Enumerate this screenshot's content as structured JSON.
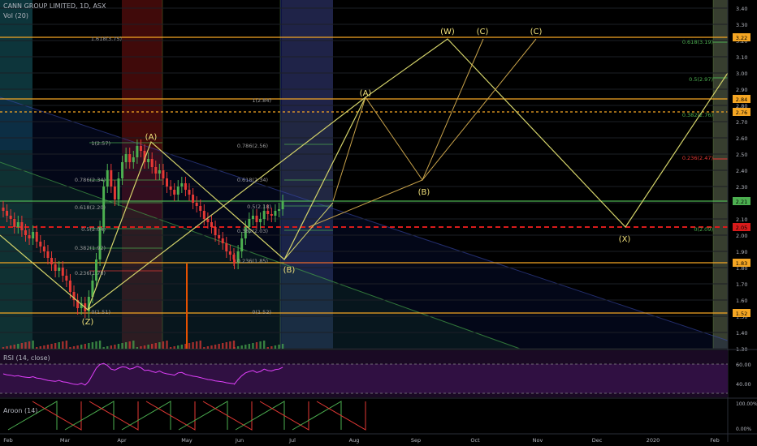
{
  "header": {
    "symbol_title": "CANN GROUP LIMITED, 1D, ASX",
    "volume_label": "Vol (20)",
    "rsi_label": "RSI (14, close)",
    "aroon_label": "Aroon (14)"
  },
  "colors": {
    "up": "#4caf50",
    "down": "#e53935",
    "orange": "#f5a623",
    "yellow_line": "#d4d36a",
    "rsi": "#e040fb",
    "axis_text": "#b2b5be",
    "dashed_red": "#d81b1b"
  },
  "chart_data": {
    "type": "candlestick",
    "title": "CANN GROUP LIMITED, 1D, ASX",
    "ylim": [
      1.3,
      3.45
    ],
    "y_ticks": [
      "1.30",
      "1.40",
      "1.50",
      "1.60",
      "1.70",
      "1.80",
      "1.90",
      "2.00",
      "2.10",
      "2.20",
      "2.30",
      "2.40",
      "2.50",
      "2.60",
      "2.70",
      "2.80",
      "2.90",
      "3.00",
      "3.10",
      "3.20",
      "3.30",
      "3.40"
    ],
    "x_ticks": [
      "Feb",
      "Mar",
      "Apr",
      "May",
      "Jun",
      "Jul",
      "Aug",
      "Sep",
      "Oct",
      "Nov",
      "Dec",
      "2020",
      "Feb"
    ],
    "price_badges": [
      {
        "label": "3.22",
        "value": 3.22,
        "color": "#f5a623"
      },
      {
        "label": "2.84",
        "value": 2.84,
        "color": "#f5a623"
      },
      {
        "label": "2.76",
        "value": 2.76,
        "color": "#f5a623"
      },
      {
        "label": "2.21",
        "value": 2.21,
        "color": "#4caf50"
      },
      {
        "label": "2.05",
        "value": 2.05,
        "color": "#d81b1b"
      },
      {
        "label": "1.83",
        "value": 1.83,
        "color": "#f5a623"
      },
      {
        "label": "1.52",
        "value": 1.52,
        "color": "#f5a623"
      }
    ],
    "horizontal_levels": [
      3.22,
      2.84,
      2.76,
      2.21,
      2.05,
      1.83,
      1.52
    ],
    "wave_labels": [
      {
        "label": "(A)",
        "x_day": 40,
        "value": 2.6
      },
      {
        "label": "(Z)",
        "x_day": 22,
        "value": 1.45
      },
      {
        "label": "(B)",
        "x_day": 80,
        "value": 1.78
      },
      {
        "label": "(A)",
        "x_day": 100,
        "value": 2.86
      },
      {
        "label": "(W)",
        "x_day": 124,
        "value": 3.27
      },
      {
        "label": "(C)",
        "x_day": 134,
        "value": 3.27
      },
      {
        "label": "(C)",
        "x_day": 151,
        "value": 3.27
      },
      {
        "label": "(B)",
        "x_day": 118,
        "value": 2.26
      },
      {
        "label": "(X)",
        "x_day": 175,
        "value": 1.96
      }
    ],
    "fib_labels": [
      {
        "label": "1.618(3.75)",
        "x_day": 27,
        "value": 3.22
      },
      {
        "label": "1(2.84)",
        "x_day": 72,
        "value": 2.84
      },
      {
        "label": "0.786(2.56)",
        "x_day": 70,
        "value": 2.56
      },
      {
        "label": "0.618(2.34)",
        "x_day": 70,
        "value": 2.34
      },
      {
        "label": "0.5(2.18)",
        "x_day": 72,
        "value": 2.18
      },
      {
        "label": "0.382(2.03)",
        "x_day": 70,
        "value": 2.03
      },
      {
        "label": "0.236(1.85)",
        "x_day": 70,
        "value": 1.83
      },
      {
        "label": "0(1.52)",
        "x_day": 72,
        "value": 1.52
      },
      {
        "label": "1(2.57)",
        "x_day": 29,
        "value": 2.57
      },
      {
        "label": "0.786(2.34)",
        "x_day": 26,
        "value": 2.34
      },
      {
        "label": "0.618(2.20)",
        "x_day": 26,
        "value": 2.2
      },
      {
        "label": "0.5(2.04)",
        "x_day": 26,
        "value": 2.04
      },
      {
        "label": "0.382(1.92)",
        "x_day": 26,
        "value": 1.92
      },
      {
        "label": "0.236(1.78)",
        "x_day": 26,
        "value": 1.78
      },
      {
        "label": "0(1.51)",
        "x_day": 29,
        "value": 1.52
      },
      {
        "label": "0.618(3.19)",
        "x_day": 194,
        "value": 3.19
      },
      {
        "label": "0.5(2.97)",
        "x_day": 196,
        "value": 2.97
      },
      {
        "label": "0.382(2.76)",
        "x_day": 194,
        "value": 2.76
      },
      {
        "label": "0.236(2.47)",
        "x_day": 194,
        "value": 2.47
      },
      {
        "label": "0(2.09)",
        "x_day": 197,
        "value": 2.05
      }
    ],
    "rsi_ticks": [
      "60.00",
      "40.00"
    ],
    "aroon_ticks": [
      "100.00%",
      "0.00%"
    ]
  }
}
